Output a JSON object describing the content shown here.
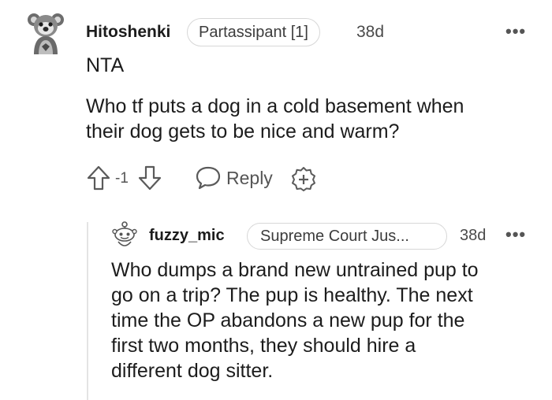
{
  "comment": {
    "username": "Hitoshenki",
    "flair": "Partassipant [1]",
    "time": "38d",
    "more": "•••",
    "verdict": "NTA",
    "body_lines": [
      "Who tf puts a dog in a cold basement when",
      "their dog gets to be nice and warm?"
    ],
    "vote_count": "-1",
    "reply_label": "Reply"
  },
  "reply": {
    "username": "fuzzy_mic",
    "flair": "Supreme Court Jus...",
    "time": "38d",
    "more": "•••",
    "body_lines": [
      "Who dumps a brand new untrained pup to",
      "go on a trip? The pup is healthy. The next",
      "time the OP abandons a new pup for the",
      "first two months, they should hire a",
      "different dog sitter."
    ]
  }
}
